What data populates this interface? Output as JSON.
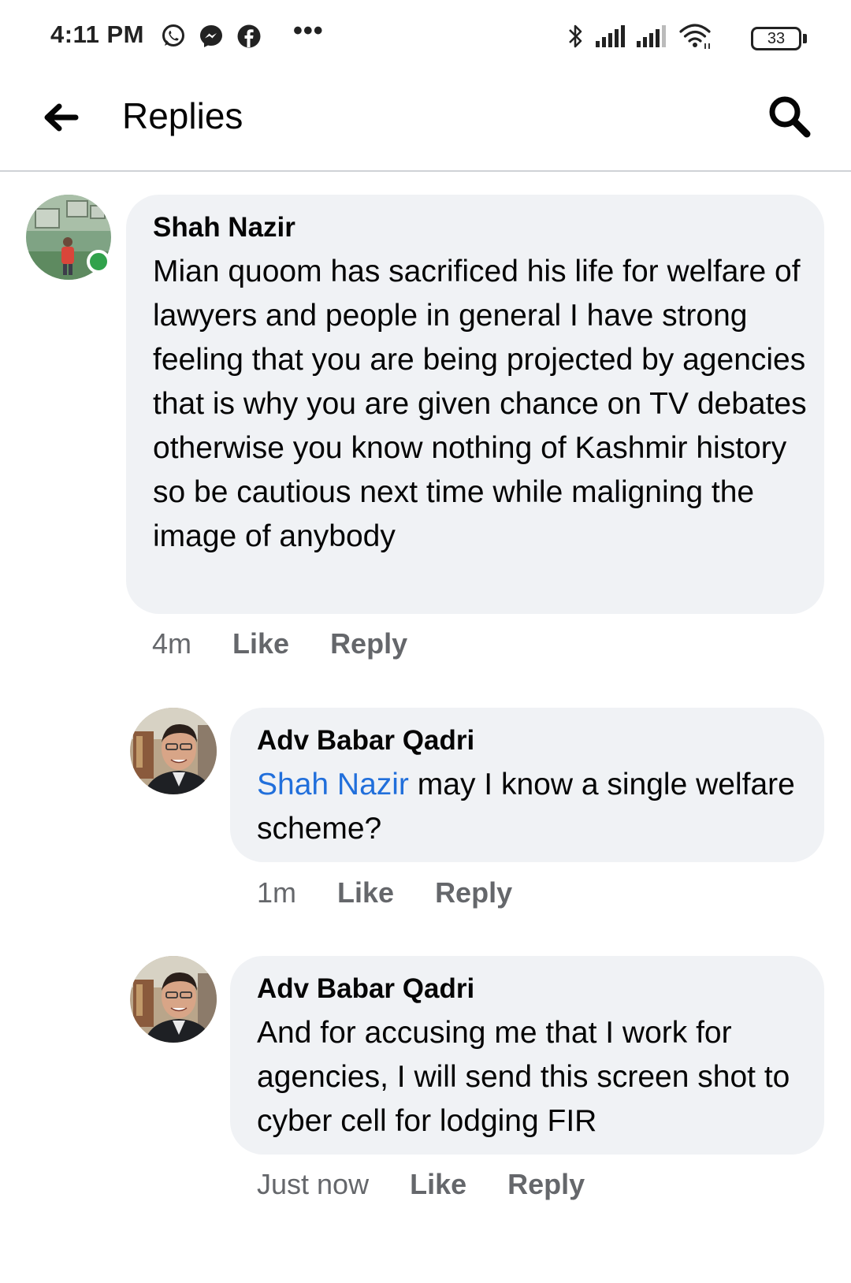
{
  "status_bar": {
    "time": "4:11 PM",
    "overflow": "•••",
    "battery": "33",
    "icons": [
      "whatsapp-icon",
      "messenger-icon",
      "facebook-icon",
      "bluetooth-icon",
      "signal-icon",
      "signal-icon",
      "wifi-icon",
      "battery-icon"
    ]
  },
  "header": {
    "title": "Replies",
    "back_icon": "arrow-left-icon",
    "search_icon": "search-icon"
  },
  "comments": [
    {
      "author": "Shah Nazir",
      "text": "Mian quoom has sacrificed his life for welfare of lawyers and people in general I have strong feeling that you are being projected by agencies that is why you are given chance on TV debates otherwise you know nothing of Kashmir history so be cautious next time while maligning the image of anybody",
      "time": "4m",
      "like": "Like",
      "reply": "Reply"
    },
    {
      "author": "Adv Babar Qadri",
      "mention": "Shah Nazir",
      "text": " may I know a single welfare scheme?",
      "time": "1m",
      "like": "Like",
      "reply": "Reply"
    },
    {
      "author": "Adv Babar Qadri",
      "text": "And for accusing me that I work for agencies, I will send this screen shot to cyber cell for lodging FIR",
      "time": "Just now",
      "like": "Like",
      "reply": "Reply"
    }
  ],
  "colors": {
    "bubble": "#f0f2f5",
    "mention": "#216fdb",
    "meta": "#65676b",
    "online": "#31a24c"
  }
}
